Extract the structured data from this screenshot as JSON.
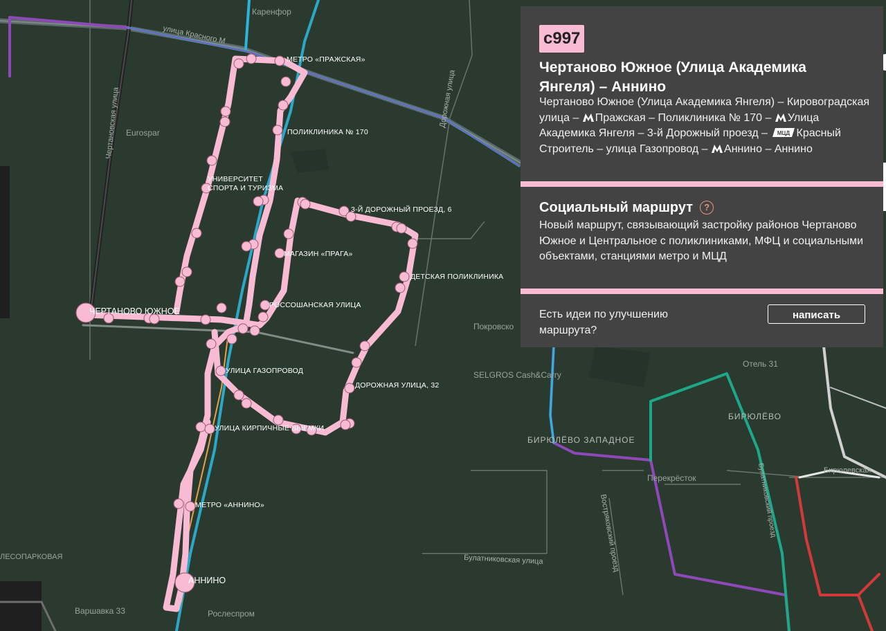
{
  "map": {
    "labels": {
      "korenfor": "Каренфор",
      "eurospar": "Eurospar",
      "pokrovskoe": "Покровско",
      "selgros": "SELGROS Cash&Carry",
      "otel": "Отель 31",
      "biryulevo": "БИРЮЛЁВО",
      "biryulevo_zapadnoe": "БИРЮЛЁВО ЗАПАДНОЕ",
      "perekrestok": "Перекрёсток",
      "rosles": "Рослеспром",
      "varshavka": "Варшавка 33",
      "lesopark": "ЛЕСОПАРКОВАЯ",
      "ul_krasnogo": "улица Красного М",
      "chertanovskaya": "Чертановская улица",
      "dorozhnaya": "Дорожная улица",
      "bulatnikovskaya": "Булатниковская улица",
      "vostryakovsky": "Востряковский проезд",
      "bulatnikovsky_proezd": "Булатниковский проезд",
      "biryulevskaya": "Бирюлевская"
    },
    "stops": {
      "metro_prazhskaya": "МЕТРО «ПРАЖСКАЯ»",
      "poliklinika_170": "ПОЛИКЛИНИКА № 170",
      "universitet_1": "УНИВЕРСИТЕТ",
      "universitet_2": "СПОРТА И ТУРИЗМА",
      "dorozhny_proezd": "3-Й ДОРОЖНЫЙ ПРОЕЗД, 6",
      "magazin_praga": "МАГАЗИН «ПРАГА»",
      "detskaya_poliklinika": "ДЕТСКАЯ ПОЛИКЛИНИКА",
      "chertanovo_yuzhnoe": "ЧЕРТАНОВО ЮЖНОЕ",
      "rossoshanskaya": "РОССОШАНСКАЯ УЛИЦА",
      "gazoprovod": "УЛИЦА ГАЗОПРОВОД",
      "dorozhnaya_32": "ДОРОЖНАЯ УЛИЦА, 32",
      "kirpichnye": "УЛИЦА КИРПИЧНЫЕ ВЫЕМКИ",
      "metro_annino": "МЕТРО «АННИНО»",
      "annino": "АННИНО"
    }
  },
  "panel": {
    "route_number": "с997",
    "route_title": "Чертаново Южное (Улица Академика Янгеля) – Аннино",
    "stops_text": {
      "p1": "Чертаново Южное (Улица Академика Янгеля) – Кировоградская улица – ",
      "p2": "Пражская – Поликлиника № 170 – ",
      "p3": "Улица Академика Янгеля – 3-й Дорожный проезд – ",
      "p4": "Красный Строитель – улица Газопровод – ",
      "p5": "Аннино – Аннино"
    },
    "mcd_badge": "МЦД",
    "social_title": "Социальный маршрут",
    "help_glyph": "?",
    "social_description": "Новый маршрут, связывающий застройку районов Чертаново Южное и Центральное с поликлиниками, МФЦ и социальными объектами, станциями метро и МЦД",
    "ideas_text": "Есть идеи по улучшению маршрута?",
    "write_button": "написать"
  },
  "colors": {
    "background": "#2b3a2f",
    "route_pink": "#f8bbd3",
    "panel_bg": "#434343",
    "metro_purple": "#8e49b8",
    "metro_cyan": "#2bb5d8",
    "metro_teal": "#1fa888",
    "metro_red": "#d23a3a"
  }
}
